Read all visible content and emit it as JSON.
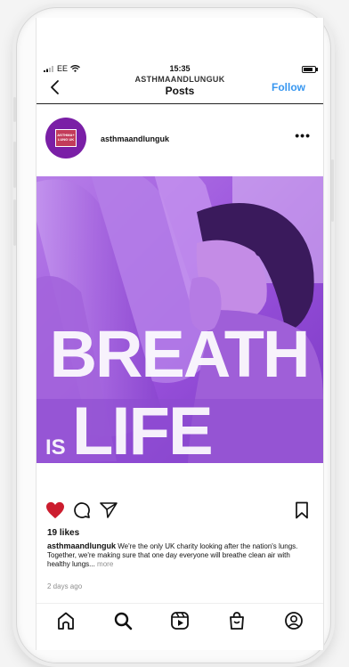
{
  "status_bar": {
    "carrier": "EE",
    "time": "15:35"
  },
  "header": {
    "account": "ASTHMAANDLUNGUK",
    "title": "Posts",
    "follow_label": "Follow"
  },
  "post": {
    "username": "asthmaandlunguk",
    "avatar_text": "ASTHMA+ LUNG UK",
    "image_text": {
      "line1": "BREATH",
      "is": "IS",
      "line2": "LIFE"
    },
    "likes": "19 likes",
    "caption_user": "asthmaandlunguk",
    "caption_text": "We're the only UK charity looking after the nation's lungs. Together, we're making sure that one day everyone will breathe clean air with healthy lungs...",
    "caption_more": "more",
    "timestamp": "2 days ago"
  },
  "colors": {
    "follow": "#3897f0",
    "heart": "#cc1d2e",
    "image_tint": "#8f3fd6"
  },
  "icons": {
    "back": "chevron-left-icon",
    "more": "more-horizontal-icon",
    "like": "heart-icon",
    "comment": "comment-icon",
    "share": "send-icon",
    "save": "bookmark-icon",
    "nav": [
      "home-icon",
      "search-icon",
      "reels-icon",
      "shop-icon",
      "profile-icon"
    ]
  }
}
